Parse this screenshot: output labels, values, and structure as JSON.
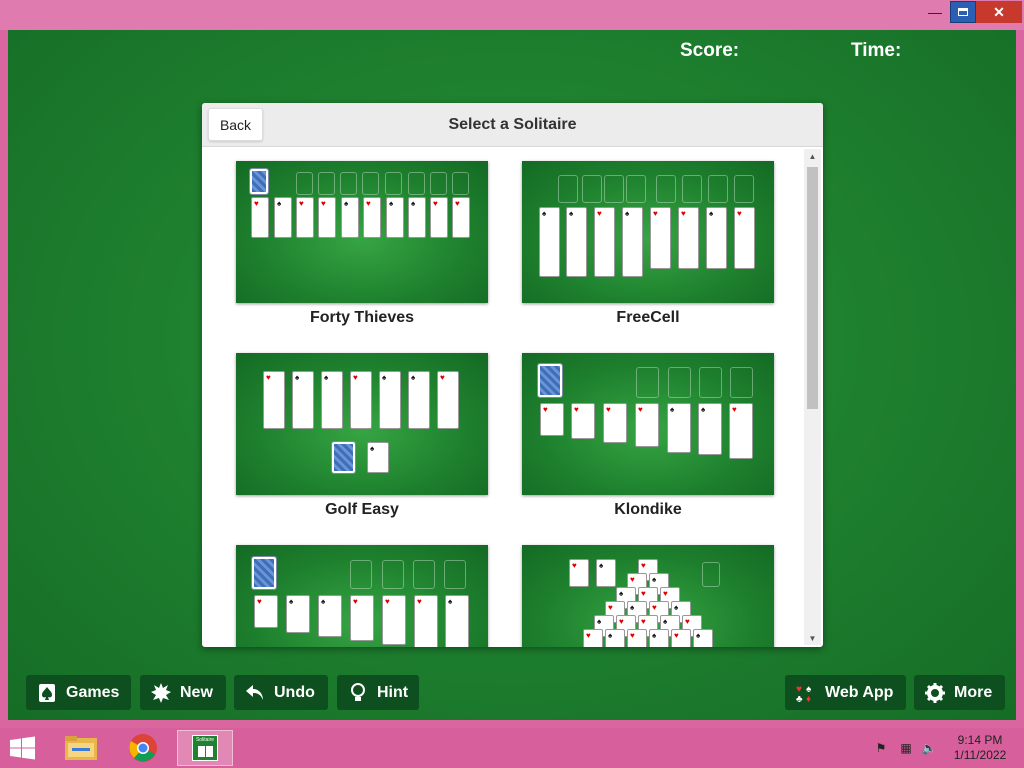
{
  "window": {
    "minimize_label": "—",
    "close_label": "✕"
  },
  "game": {
    "score_label": "Score:",
    "time_label": "Time:"
  },
  "dialog": {
    "title": "Select a Solitaire",
    "back_label": "Back",
    "games": [
      {
        "label": "Forty Thieves"
      },
      {
        "label": "FreeCell"
      },
      {
        "label": "Golf Easy"
      },
      {
        "label": "Klondike"
      }
    ]
  },
  "toolbar": {
    "games_label": "Games",
    "new_label": "New",
    "undo_label": "Undo",
    "hint_label": "Hint",
    "webapp_label": "Web App",
    "more_label": "More"
  },
  "taskbar": {
    "app_thumb_label": "Solitaire",
    "time": "9:14 PM",
    "date": "1/11/2022"
  },
  "colors": {
    "felt": "#1f8230",
    "button_bg": "#0d4f1e",
    "frame": "#d9669f"
  }
}
